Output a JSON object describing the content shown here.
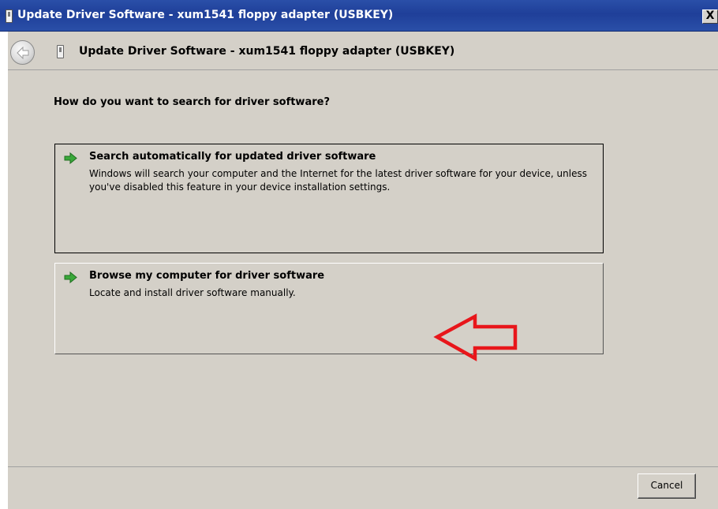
{
  "window": {
    "title": "Update Driver Software - xum1541 floppy adapter (USBKEY)",
    "close_label": "X"
  },
  "header": {
    "title": "Update Driver Software - xum1541 floppy adapter (USBKEY)"
  },
  "main": {
    "question": "How do you want to search for driver software?",
    "options": [
      {
        "title": "Search automatically for updated driver software",
        "description": "Windows will search your computer and the Internet for the latest driver software for your device, unless you've disabled this feature in your device installation settings.",
        "icon": "green-arrow-icon"
      },
      {
        "title": "Browse my computer for driver software",
        "description": "Locate and install driver software manually.",
        "icon": "green-arrow-icon"
      }
    ],
    "annotation": {
      "icon": "red-arrow-icon",
      "color": "#e8161b"
    }
  },
  "footer": {
    "cancel_label": "Cancel"
  },
  "colors": {
    "titlebar": "#1f3f99",
    "window_bg": "#d4d0c8",
    "accent_green": "#2e9d2e"
  }
}
